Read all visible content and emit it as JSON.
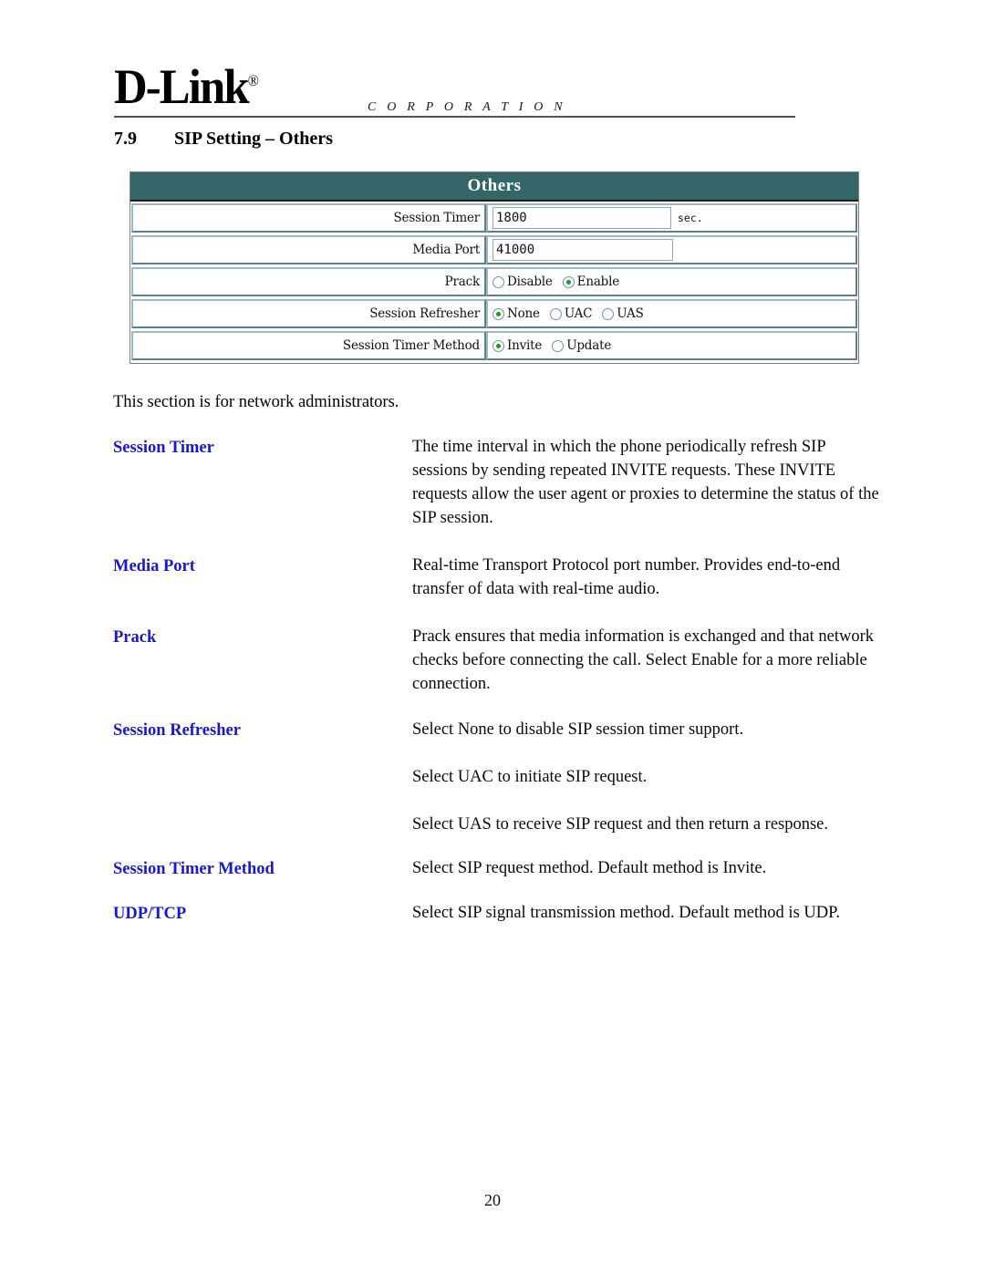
{
  "header": {
    "logo_text": "D-Link",
    "logo_registered": "®",
    "logo_subtitle": "C O R P O R A T I O N"
  },
  "section": {
    "number": "7.9",
    "title": "SIP Setting – Others"
  },
  "panel": {
    "title": "Others",
    "accent_color": "#336666",
    "rows": [
      {
        "label": "Session Timer",
        "type": "text",
        "value": "1800",
        "unit": "sec."
      },
      {
        "label": "Media Port",
        "type": "text",
        "value": "41000",
        "unit": ""
      },
      {
        "label": "Prack",
        "type": "radio",
        "options": [
          {
            "label": "Disable",
            "selected": false
          },
          {
            "label": "Enable",
            "selected": true
          }
        ]
      },
      {
        "label": "Session Refresher",
        "type": "radio",
        "options": [
          {
            "label": "None",
            "selected": true
          },
          {
            "label": "UAC",
            "selected": false
          },
          {
            "label": "UAS",
            "selected": false
          }
        ]
      },
      {
        "label": "Session Timer Method",
        "type": "radio",
        "options": [
          {
            "label": "Invite",
            "selected": true
          },
          {
            "label": "Update",
            "selected": false
          }
        ]
      }
    ]
  },
  "body": {
    "intro": "This section is for network administrators.",
    "term_color": "#1818d0",
    "definitions": [
      {
        "term": "Session Timer",
        "paragraphs": [
          "The time interval in which the phone periodically refresh SIP sessions by sending repeated INVITE requests. These INVITE requests allow the user agent or proxies to determine the status of the SIP session."
        ]
      },
      {
        "term": "Media Port",
        "paragraphs": [
          "Real-time Transport Protocol port number. Provides end-to-end transfer of data with real-time audio."
        ]
      },
      {
        "term": "Prack",
        "paragraphs": [
          "Prack ensures that media information is exchanged and that network checks before connecting the call. Select Enable for a more reliable connection."
        ]
      },
      {
        "term": "Session Refresher",
        "paragraphs": [
          "Select None to disable SIP session timer support.",
          "Select UAC to initiate SIP request.",
          "Select UAS to receive SIP request and then return a response."
        ]
      },
      {
        "term": "Session Timer Method",
        "paragraphs": [
          "Select SIP request method. Default method is Invite."
        ]
      },
      {
        "term": "UDP/TCP",
        "paragraphs": [
          "Select SIP signal transmission method. Default method is UDP."
        ]
      }
    ]
  },
  "footer": {
    "page_number": "20"
  }
}
